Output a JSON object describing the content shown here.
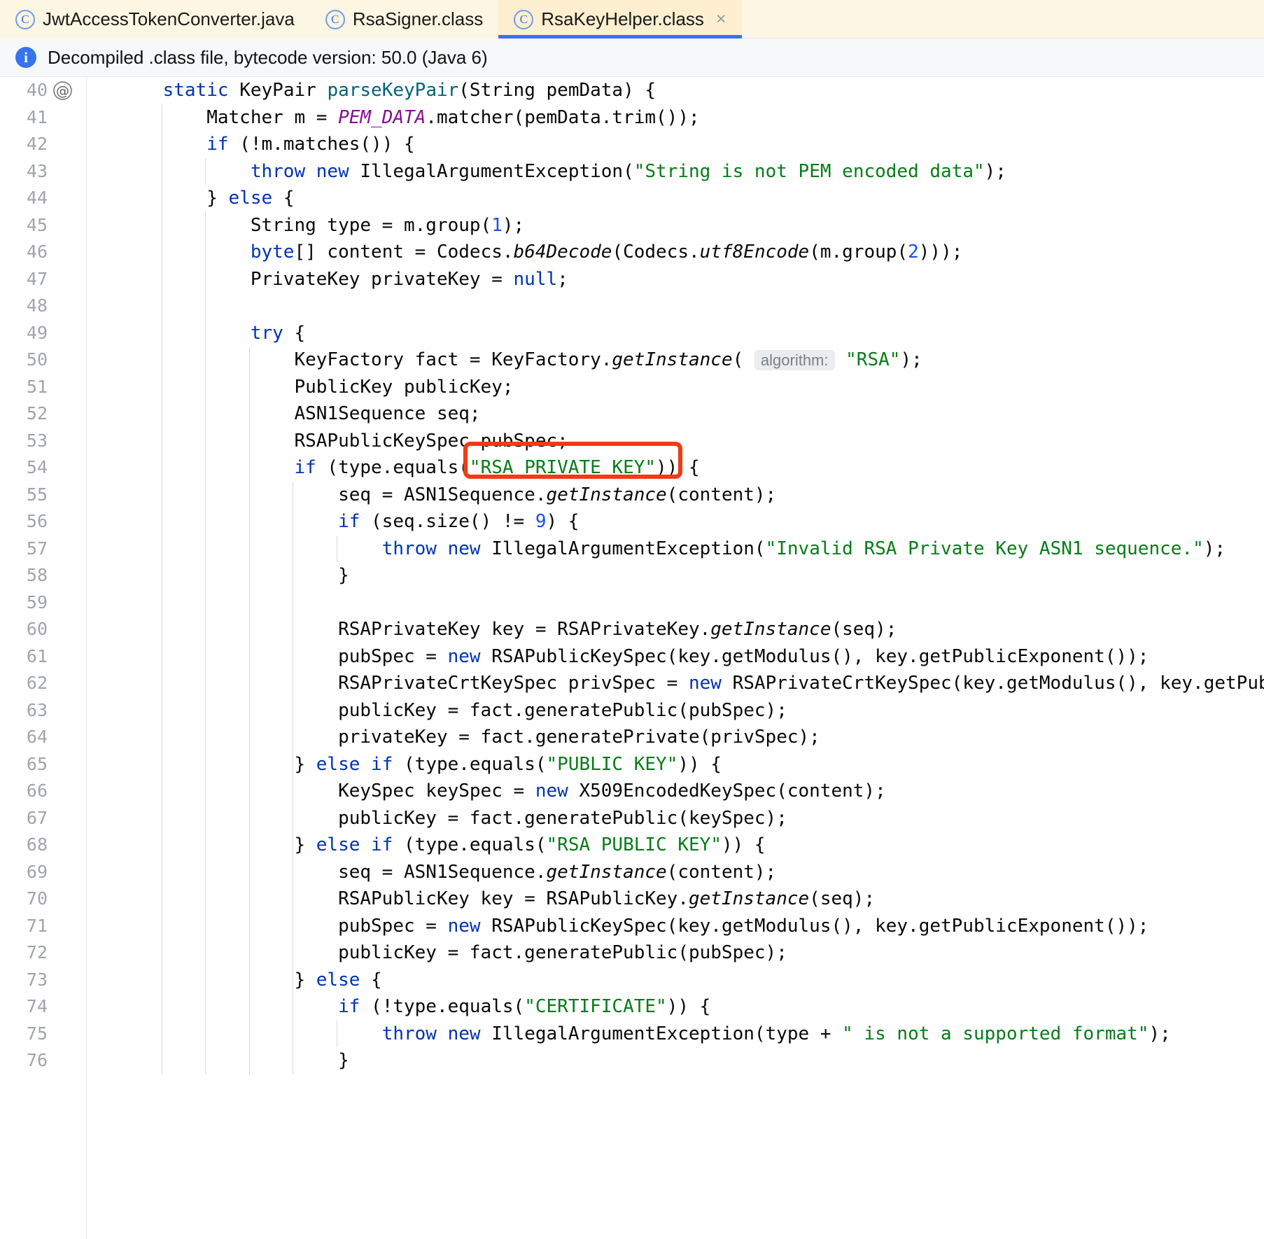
{
  "tabs": [
    {
      "label": "JwtAccessTokenConverter.java",
      "icon": "java-class-icon",
      "active": false,
      "closable": false
    },
    {
      "label": "RsaSigner.class",
      "icon": "java-class-icon",
      "active": false,
      "closable": false
    },
    {
      "label": "RsaKeyHelper.class",
      "icon": "java-class-icon",
      "active": true,
      "closable": true,
      "close_glyph": "×"
    }
  ],
  "notification": {
    "icon": "info-icon",
    "glyph": "i",
    "message": "Decompiled .class file, bytecode version: 50.0 (Java 6)"
  },
  "annotation": {
    "color": "#f03b15",
    "target_text": "\"RSA PRIVATE KEY\"",
    "target_line": 54
  },
  "colors": {
    "keyword": "#0033b3",
    "string": "#067d17",
    "number": "#1750eb",
    "static_field": "#871094",
    "declaration": "#00627a",
    "line_number": "#a0a4ab",
    "tab_active_bg": "#fdefd0",
    "tab_bg": "#fdf6e3",
    "tab_underline": "#3574f0",
    "info_bar_bg": "#f7f8fa"
  },
  "editor": {
    "gutter_marker_line": 40,
    "gutter_marker_glyph": "@",
    "first_line": 40,
    "last_line": 76,
    "lines": [
      {
        "n": 40,
        "marker": "@",
        "text": "    static KeyPair parseKeyPair(String pemData) {"
      },
      {
        "n": 41,
        "text": "        Matcher m = PEM_DATA.matcher(pemData.trim());"
      },
      {
        "n": 42,
        "text": "        if (!m.matches()) {"
      },
      {
        "n": 43,
        "text": "            throw new IllegalArgumentException(\"String is not PEM encoded data\");"
      },
      {
        "n": 44,
        "text": "        } else {"
      },
      {
        "n": 45,
        "text": "            String type = m.group(1);"
      },
      {
        "n": 46,
        "text": "            byte[] content = Codecs.b64Decode(Codecs.utf8Encode(m.group(2)));"
      },
      {
        "n": 47,
        "text": "            PrivateKey privateKey = null;"
      },
      {
        "n": 48,
        "text": ""
      },
      {
        "n": 49,
        "text": "            try {"
      },
      {
        "n": 50,
        "text": "                KeyFactory fact = KeyFactory.getInstance( algorithm: \"RSA\");"
      },
      {
        "n": 51,
        "text": "                PublicKey publicKey;"
      },
      {
        "n": 52,
        "text": "                ASN1Sequence seq;"
      },
      {
        "n": 53,
        "text": "                RSAPublicKeySpec pubSpec;"
      },
      {
        "n": 54,
        "text": "                if (type.equals(\"RSA PRIVATE KEY\")) {"
      },
      {
        "n": 55,
        "text": "                    seq = ASN1Sequence.getInstance(content);"
      },
      {
        "n": 56,
        "text": "                    if (seq.size() != 9) {"
      },
      {
        "n": 57,
        "text": "                        throw new IllegalArgumentException(\"Invalid RSA Private Key ASN1 sequence.\");"
      },
      {
        "n": 58,
        "text": "                    }"
      },
      {
        "n": 59,
        "text": ""
      },
      {
        "n": 60,
        "text": "                    RSAPrivateKey key = RSAPrivateKey.getInstance(seq);"
      },
      {
        "n": 61,
        "text": "                    pubSpec = new RSAPublicKeySpec(key.getModulus(), key.getPublicExponent());"
      },
      {
        "n": 62,
        "text": "                    RSAPrivateCrtKeySpec privSpec = new RSAPrivateCrtKeySpec(key.getModulus(), key.getPubli"
      },
      {
        "n": 63,
        "text": "                    publicKey = fact.generatePublic(pubSpec);"
      },
      {
        "n": 64,
        "text": "                    privateKey = fact.generatePrivate(privSpec);"
      },
      {
        "n": 65,
        "text": "                } else if (type.equals(\"PUBLIC KEY\")) {"
      },
      {
        "n": 66,
        "text": "                    KeySpec keySpec = new X509EncodedKeySpec(content);"
      },
      {
        "n": 67,
        "text": "                    publicKey = fact.generatePublic(keySpec);"
      },
      {
        "n": 68,
        "text": "                } else if (type.equals(\"RSA PUBLIC KEY\")) {"
      },
      {
        "n": 69,
        "text": "                    seq = ASN1Sequence.getInstance(content);"
      },
      {
        "n": 70,
        "text": "                    RSAPublicKey key = RSAPublicKey.getInstance(seq);"
      },
      {
        "n": 71,
        "text": "                    pubSpec = new RSAPublicKeySpec(key.getModulus(), key.getPublicExponent());"
      },
      {
        "n": 72,
        "text": "                    publicKey = fact.generatePublic(pubSpec);"
      },
      {
        "n": 73,
        "text": "                } else {"
      },
      {
        "n": 74,
        "text": "                    if (!type.equals(\"CERTIFICATE\")) {"
      },
      {
        "n": 75,
        "text": "                        throw new IllegalArgumentException(type + \" is not a supported format\");"
      },
      {
        "n": 76,
        "text": "                    }"
      }
    ]
  }
}
